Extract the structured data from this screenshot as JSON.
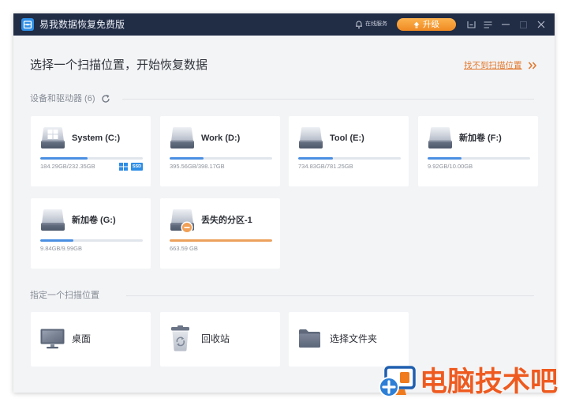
{
  "window": {
    "title": "易我数据恢复免费版",
    "app_icon": "app-logo-icon",
    "online_service": "在线服务",
    "online_service_icon": "customer-service-icon",
    "upgrade_label": "升级",
    "upgrade_icon": "upgrade-arrow-icon",
    "controls": [
      "inbox-icon",
      "menu-icon",
      "minimize-icon",
      "maximize-icon",
      "close-icon"
    ]
  },
  "main": {
    "heading": "选择一个扫描位置，开始恢复数据",
    "help_link": "找不到扫描位置",
    "help_link_icon": "double-chevron-right-icon"
  },
  "devices": {
    "section_label": "设备和驱动器 (6)",
    "section_icon": "refresh-icon",
    "drives": [
      {
        "label": "System (C:)",
        "size": "184.29GB/232.35GB",
        "usage": 0.46,
        "icon": "system-drive-icon",
        "badge_icon": "windows-logo-icon",
        "badge": "SSD"
      },
      {
        "label": "Work (D:)",
        "size": "395.56GB/398.17GB",
        "usage": 0.33,
        "icon": "drive-icon"
      },
      {
        "label": "Tool (E:)",
        "size": "734.83GB/781.25GB",
        "usage": 0.34,
        "icon": "drive-icon"
      },
      {
        "label": "新加卷 (F:)",
        "size": "9.92GB/10.00GB",
        "usage": 0.33,
        "icon": "drive-icon"
      },
      {
        "label": "新加卷 (G:)",
        "size": "9.84GB/9.99GB",
        "usage": 0.32,
        "icon": "drive-icon"
      },
      {
        "label": "丢失的分区-1",
        "size": "663.59 GB",
        "usage": 1.0,
        "icon": "lost-partition-icon"
      }
    ]
  },
  "locations": {
    "section_label": "指定一个扫描位置",
    "items": [
      {
        "label": "桌面",
        "icon": "desktop-icon"
      },
      {
        "label": "回收站",
        "icon": "recycle-bin-icon"
      },
      {
        "label": "选择文件夹",
        "icon": "folder-icon"
      }
    ]
  },
  "watermark": {
    "text": "电脑技术吧",
    "icon": "watermark-logo-icon"
  },
  "colors": {
    "titlebar": "#212c45",
    "body": "#f3f4f6",
    "upgrade_orange": "#f39a2f",
    "link_orange": "#e3782c",
    "bar_blue": "#4a8fe2",
    "bar_lost": "#eca15c",
    "watermark": "#ee5a1f"
  }
}
